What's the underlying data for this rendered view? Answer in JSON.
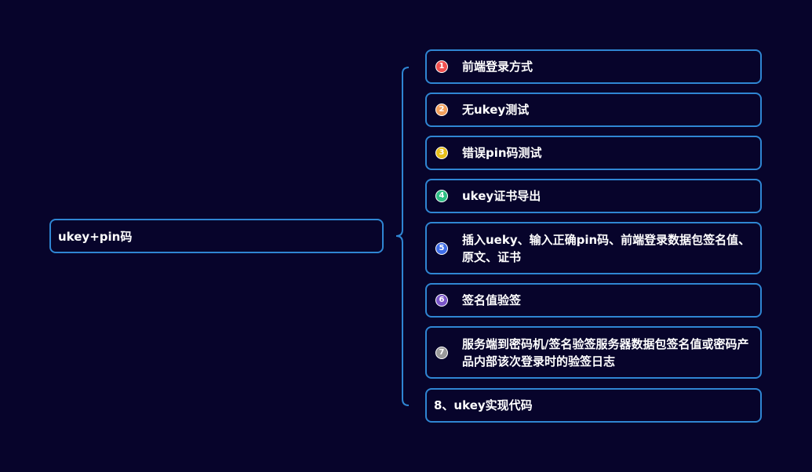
{
  "root": {
    "label": "ukey+pin码"
  },
  "colors": {
    "background": "#07042b",
    "node_border": "#2f86d3",
    "text": "#ffffff"
  },
  "children": [
    {
      "badge": "1",
      "badge_color": "#f0504f",
      "label": "前端登录方式"
    },
    {
      "badge": "2",
      "badge_color": "#f4a15d",
      "label": "无ukey测试"
    },
    {
      "badge": "3",
      "badge_color": "#e7c01a",
      "label": "错误pin码测试"
    },
    {
      "badge": "4",
      "badge_color": "#2fbf85",
      "label": "ukey证书导出"
    },
    {
      "badge": "5",
      "badge_color": "#3f6ee8",
      "label": "插入ueky、输入正确pin码、前端登录数据包签名值、原文、证书"
    },
    {
      "badge": "6",
      "badge_color": "#7a55c9",
      "label": "签名值验签"
    },
    {
      "badge": "7",
      "badge_color": "#9a9a9a",
      "label": "服务端到密码机/签名验签服务器数据包签名值或密码产品内部该次登录时的验签日志"
    },
    {
      "label": "8、ukey实现代码"
    }
  ]
}
